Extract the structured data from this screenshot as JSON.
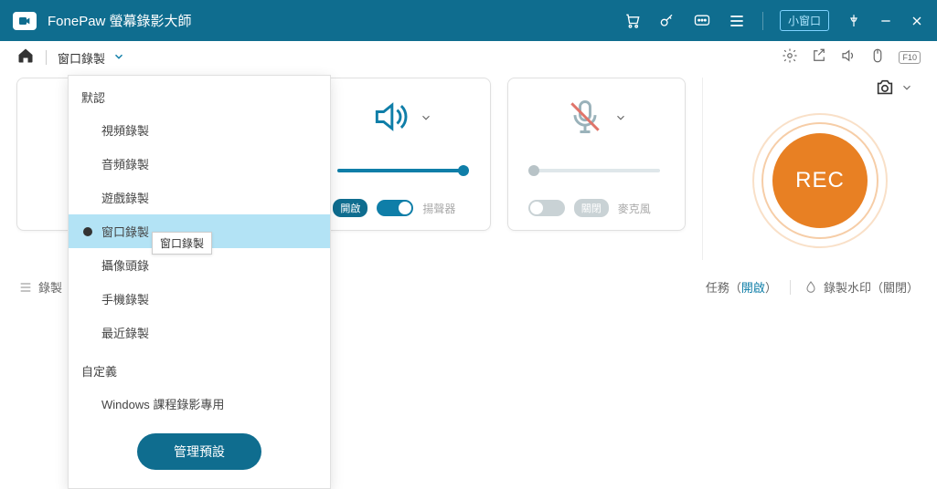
{
  "titlebar": {
    "app_name": "FonePaw 螢幕錄影大師",
    "small_window": "小窗口"
  },
  "toolbar": {
    "mode_label": "窗口錄製",
    "f10": "F10"
  },
  "panels": {
    "speaker": {
      "toggle_state": "開啟",
      "label": "揚聲器"
    },
    "mic": {
      "toggle_state": "關閉",
      "label": "麥克風"
    }
  },
  "rec": {
    "label": "REC"
  },
  "status": {
    "history": "錄製",
    "task_prefix": "任務（",
    "task_state": "開啟",
    "task_suffix": "）",
    "watermark_prefix": "錄製水印（",
    "watermark_state": "關閉",
    "watermark_suffix": "）"
  },
  "dropdown": {
    "section_default": "默認",
    "items_default": [
      "視頻錄製",
      "音頻錄製",
      "遊戲錄製",
      "窗口錄製",
      "攝像頭錄",
      "手機錄製",
      "最近錄製"
    ],
    "section_custom": "自定義",
    "items_custom": [
      "Windows 課程錄影專用"
    ],
    "manage_btn": "管理預設",
    "tooltip": "窗口錄製"
  }
}
